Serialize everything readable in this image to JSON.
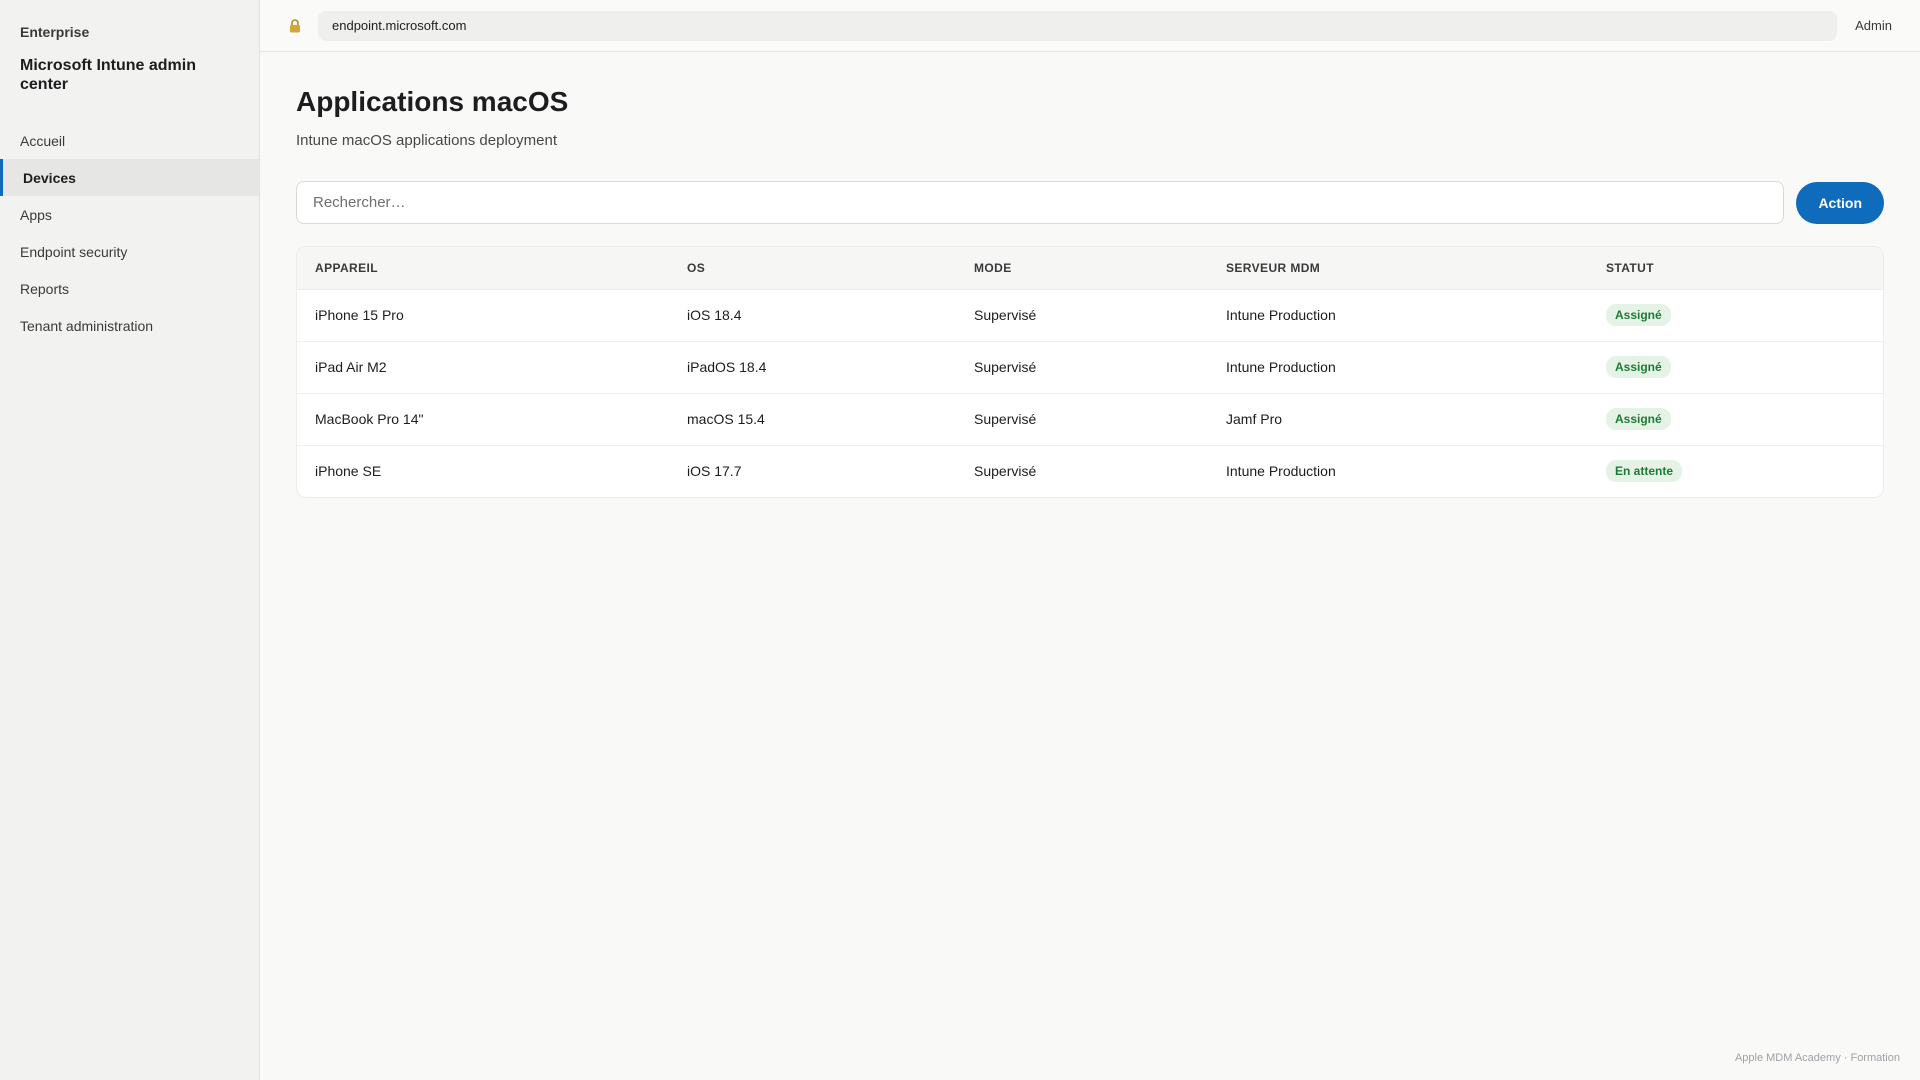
{
  "sidebar": {
    "org": "Enterprise",
    "title": "Microsoft Intune admin center",
    "items": [
      {
        "label": "Accueil"
      },
      {
        "label": "Devices"
      },
      {
        "label": "Apps"
      },
      {
        "label": "Endpoint security"
      },
      {
        "label": "Reports"
      },
      {
        "label": "Tenant administration"
      }
    ],
    "active_index": 1
  },
  "topbar": {
    "url": "endpoint.microsoft.com",
    "user": "Admin"
  },
  "page": {
    "title": "Applications macOS",
    "subtitle": "Intune macOS applications deployment"
  },
  "search": {
    "placeholder": "Rechercher…",
    "action_label": "Action"
  },
  "table": {
    "headers": [
      "APPAREIL",
      "OS",
      "MODE",
      "SERVEUR MDM",
      "STATUT"
    ],
    "rows": [
      {
        "appareil": "iPhone 15 Pro",
        "os": "iOS 18.4",
        "mode": "Supervisé",
        "serveur": "Intune Production",
        "statut": "Assigné"
      },
      {
        "appareil": "iPad Air M2",
        "os": "iPadOS 18.4",
        "mode": "Supervisé",
        "serveur": "Intune Production",
        "statut": "Assigné"
      },
      {
        "appareil": "MacBook Pro 14\"",
        "os": "macOS 15.4",
        "mode": "Supervisé",
        "serveur": "Jamf Pro",
        "statut": "Assigné"
      },
      {
        "appareil": "iPhone SE",
        "os": "iOS 17.7",
        "mode": "Supervisé",
        "serveur": "Intune Production",
        "statut": "En attente"
      }
    ]
  },
  "footer": "Apple MDM Academy · Formation",
  "colors": {
    "accent": "#0f6cbd",
    "badge_bg": "#e5f3e6",
    "badge_text": "#1e7b34"
  },
  "icons": {
    "lock": "lock-icon"
  }
}
